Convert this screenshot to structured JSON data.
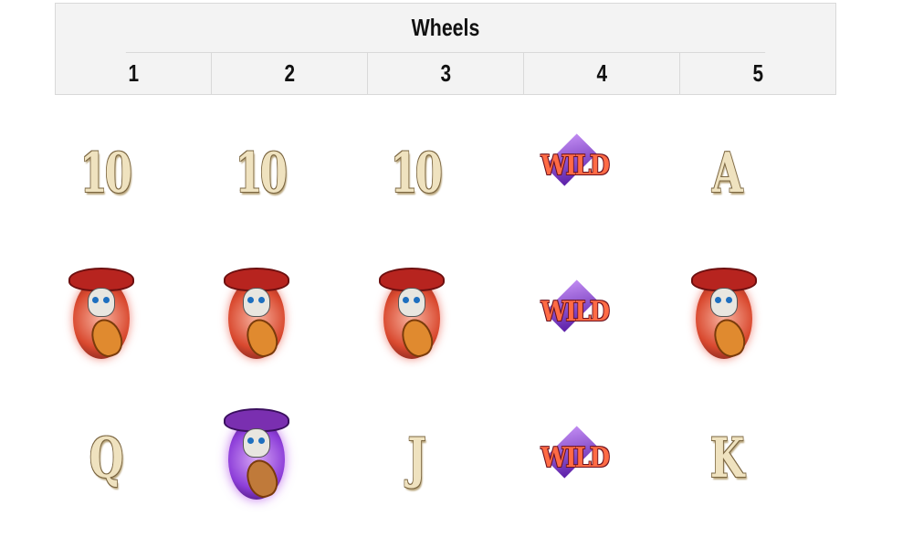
{
  "table": {
    "title": "Wheels",
    "columns": [
      "1",
      "2",
      "3",
      "4",
      "5"
    ]
  },
  "reels": [
    [
      "10",
      "skull-red",
      "Q"
    ],
    [
      "10",
      "skull-red",
      "skull-purple"
    ],
    [
      "10",
      "skull-red",
      "J"
    ],
    [
      "WILD",
      "WILD",
      "WILD"
    ],
    [
      "A",
      "skull-red",
      "K"
    ]
  ],
  "symbols": {
    "r0c0": "10",
    "r0c1": "10",
    "r0c2": "10",
    "r0c3": "WILD",
    "r0c4": "A",
    "r1c3": "WILD",
    "r2c0": "Q",
    "r2c2": "J",
    "r2c3": "WILD",
    "r2c4": "K"
  },
  "colors": {
    "header_bg": "#f3f3f3",
    "border": "#d9d9d9",
    "wild_text": "#ff6b45",
    "wild_diamond": "#7b3fc9",
    "letter_symbol": "#efe2bf"
  }
}
